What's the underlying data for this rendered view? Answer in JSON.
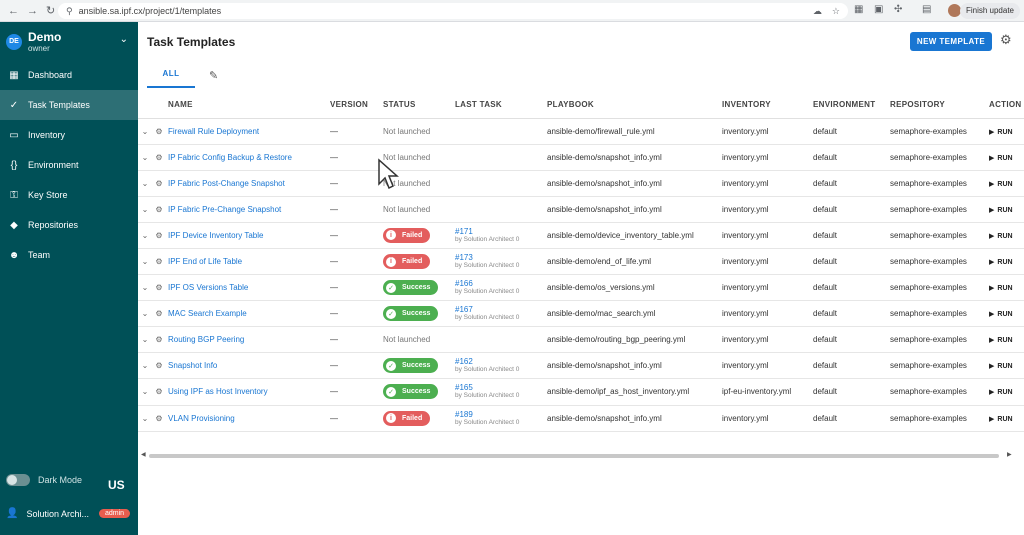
{
  "browser": {
    "url": "ansible.sa.ipf.cx/project/1/templates",
    "finish_update": "Finish update"
  },
  "sidebar": {
    "project_avatar": "DE",
    "project_name": "Demo",
    "project_role": "owner",
    "items": [
      {
        "label": "Dashboard",
        "icon": "dashboard-icon"
      },
      {
        "label": "Task Templates",
        "icon": "templates-icon"
      },
      {
        "label": "Inventory",
        "icon": "monitor-icon"
      },
      {
        "label": "Environment",
        "icon": "braces-icon"
      },
      {
        "label": "Key Store",
        "icon": "key-icon"
      },
      {
        "label": "Repositories",
        "icon": "git-icon"
      },
      {
        "label": "Team",
        "icon": "team-icon"
      }
    ],
    "dark_mode_label": "Dark Mode",
    "language": "US",
    "user_name": "Solution Archi...",
    "user_badge": "admin"
  },
  "main": {
    "title": "Task Templates",
    "new_template_label": "NEW TEMPLATE",
    "tab_all": "ALL",
    "columns": [
      "NAME",
      "VERSION",
      "STATUS",
      "LAST TASK",
      "PLAYBOOK",
      "INVENTORY",
      "ENVIRONMENT",
      "REPOSITORY",
      "ACTION"
    ],
    "rows": [
      {
        "name": "Firewall Rule Deployment",
        "version": "—",
        "status": "Not launched",
        "task": "",
        "by": "",
        "playbook": "ansible-demo/firewall_rule.yml",
        "inventory": "inventory.yml",
        "environment": "default",
        "repository": "semaphore-examples",
        "action": "RUN"
      },
      {
        "name": "IP Fabric Config Backup & Restore",
        "version": "—",
        "status": "Not launched",
        "task": "",
        "by": "",
        "playbook": "ansible-demo/snapshot_info.yml",
        "inventory": "inventory.yml",
        "environment": "default",
        "repository": "semaphore-examples",
        "action": "RUN"
      },
      {
        "name": "IP Fabric Post-Change Snapshot",
        "version": "—",
        "status": "Not launched",
        "task": "",
        "by": "",
        "playbook": "ansible-demo/snapshot_info.yml",
        "inventory": "inventory.yml",
        "environment": "default",
        "repository": "semaphore-examples",
        "action": "RUN"
      },
      {
        "name": "IP Fabric Pre-Change Snapshot",
        "version": "—",
        "status": "Not launched",
        "task": "",
        "by": "",
        "playbook": "ansible-demo/snapshot_info.yml",
        "inventory": "inventory.yml",
        "environment": "default",
        "repository": "semaphore-examples",
        "action": "RUN"
      },
      {
        "name": "IPF Device Inventory Table",
        "version": "—",
        "status": "Failed",
        "task": "#171",
        "by": "by Solution Architect 0",
        "playbook": "ansible-demo/device_inventory_table.yml",
        "inventory": "inventory.yml",
        "environment": "default",
        "repository": "semaphore-examples",
        "action": "RUN"
      },
      {
        "name": "IPF End of Life Table",
        "version": "—",
        "status": "Failed",
        "task": "#173",
        "by": "by Solution Architect 0",
        "playbook": "ansible-demo/end_of_life.yml",
        "inventory": "inventory.yml",
        "environment": "default",
        "repository": "semaphore-examples",
        "action": "RUN"
      },
      {
        "name": "IPF OS Versions Table",
        "version": "—",
        "status": "Success",
        "task": "#166",
        "by": "by Solution Architect 0",
        "playbook": "ansible-demo/os_versions.yml",
        "inventory": "inventory.yml",
        "environment": "default",
        "repository": "semaphore-examples",
        "action": "RUN"
      },
      {
        "name": "MAC Search Example",
        "version": "—",
        "status": "Success",
        "task": "#167",
        "by": "by Solution Architect 0",
        "playbook": "ansible-demo/mac_search.yml",
        "inventory": "inventory.yml",
        "environment": "default",
        "repository": "semaphore-examples",
        "action": "RUN"
      },
      {
        "name": "Routing BGP Peering",
        "version": "—",
        "status": "Not launched",
        "task": "",
        "by": "",
        "playbook": "ansible-demo/routing_bgp_peering.yml",
        "inventory": "inventory.yml",
        "environment": "default",
        "repository": "semaphore-examples",
        "action": "RUN"
      },
      {
        "name": "Snapshot Info",
        "version": "—",
        "status": "Success",
        "task": "#162",
        "by": "by Solution Architect 0",
        "playbook": "ansible-demo/snapshot_info.yml",
        "inventory": "inventory.yml",
        "environment": "default",
        "repository": "semaphore-examples",
        "action": "RUN"
      },
      {
        "name": "Using IPF as Host Inventory",
        "version": "—",
        "status": "Success",
        "task": "#165",
        "by": "by Solution Architect 0",
        "playbook": "ansible-demo/ipf_as_host_inventory.yml",
        "inventory": "ipf-eu-inventory.yml",
        "environment": "default",
        "repository": "semaphore-examples",
        "action": "RUN"
      },
      {
        "name": "VLAN Provisioning",
        "version": "—",
        "status": "Failed",
        "task": "#189",
        "by": "by Solution Architect 0",
        "playbook": "ansible-demo/snapshot_info.yml",
        "inventory": "inventory.yml",
        "environment": "default",
        "repository": "semaphore-examples",
        "action": "RUN"
      }
    ]
  },
  "colors": {
    "sidebar_bg": "#005057",
    "accent": "#1976d2",
    "failed": "#e35d5d",
    "success": "#4caf50",
    "admin_badge": "#e85d4e"
  }
}
